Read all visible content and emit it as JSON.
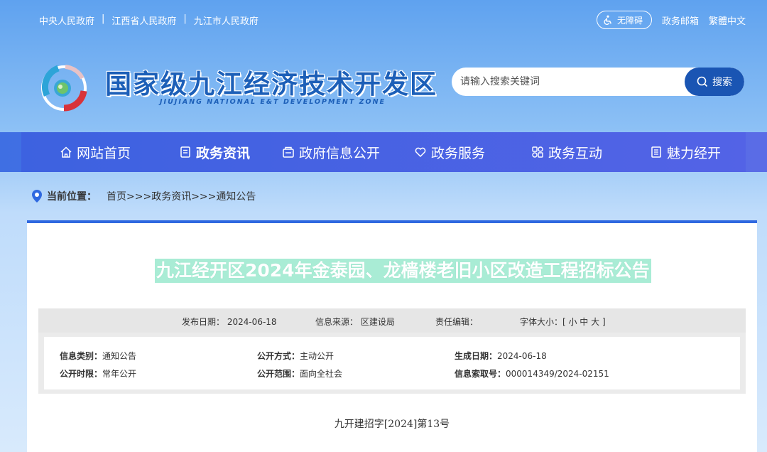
{
  "topbar": {
    "links": [
      "中央人民政府",
      "江西省人民政府",
      "九江市人民政府"
    ],
    "separator": "|",
    "accessibility_label": "无障碍",
    "mailbox_label": "政务邮箱",
    "lang_label": "繁體中文"
  },
  "header": {
    "title": "国家级九江经济技术开发区",
    "subtitle": "JIUJIANG NATIONAL E&T DEVELOPMENT ZONE",
    "search_placeholder": "请输入搜索关键词",
    "search_button": "搜索"
  },
  "nav": {
    "items": [
      {
        "label": "网站首页",
        "icon": "home-icon"
      },
      {
        "label": "政务资讯",
        "icon": "document-icon",
        "active": true
      },
      {
        "label": "政府信息公开",
        "icon": "inbox-icon"
      },
      {
        "label": "政务服务",
        "icon": "heart-icon"
      },
      {
        "label": "政务互动",
        "icon": "interact-icon"
      },
      {
        "label": "魅力经开",
        "icon": "list-icon"
      }
    ]
  },
  "breadcrumb": {
    "label": "当前位置：",
    "path": "首页>>>政务资讯>>>通知公告"
  },
  "article": {
    "title": "九江经开区2024年金泰园、龙樯楼老旧小区改造工程招标公告",
    "meta": {
      "publish_date": "发布日期：  2024-06-18",
      "source": "信息来源：  区建设局",
      "editor": "责任编辑：",
      "font_size": "字体大小：[ 小 中 大 ]"
    },
    "info": {
      "category_label": "信息类别：",
      "category_value": "通知公告",
      "method_label": "公开方式：",
      "method_value": "主动公开",
      "gen_date_label": "生成日期：",
      "gen_date_value": "2024-06-18",
      "period_label": "公开时限：",
      "period_value": "常年公开",
      "scope_label": "公开范围：",
      "scope_value": "面向全社会",
      "index_label": "信息索取号：",
      "index_value": "000014349/2024-02151"
    },
    "doc_number": "九开建招字[2024]第13号"
  },
  "colors": {
    "brand_blue": "#1c5fb8",
    "nav_blue": "#4a6be6",
    "highlight": "#a9ecd5"
  }
}
